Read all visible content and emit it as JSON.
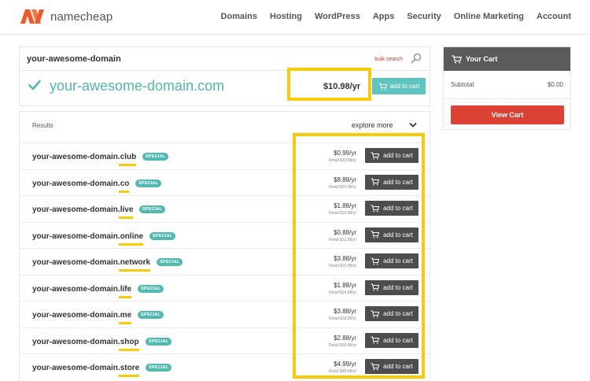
{
  "brand": {
    "name": "namecheap",
    "logo_color": "#f05a2a"
  },
  "nav": {
    "items": [
      "Domains",
      "Hosting",
      "WordPress",
      "Apps",
      "Security",
      "Online Marketing",
      "Account"
    ]
  },
  "search": {
    "value": "your-awesome-domain",
    "bulk_search_label": "bulk search",
    "icon": "search-icon"
  },
  "main_result": {
    "domain": "your-awesome-domain.com",
    "price": "$10.98/yr",
    "add_label": "add to cart",
    "status_icon": "check-icon",
    "accent_color": "#4fb8b0"
  },
  "results": {
    "label": "Results",
    "explore_more": "explore more",
    "badge_label": "SPECIAL",
    "add_label": "add to cart",
    "rows": [
      {
        "base": "your-awesome-domain",
        "tld": ".club",
        "price": "$0.99/yr",
        "retail": "Retail $10.88/yr"
      },
      {
        "base": "your-awesome-domain",
        "tld": ".co",
        "price": "$8.88/yr",
        "retail": "Retail $23.98/yr"
      },
      {
        "base": "your-awesome-domain",
        "tld": ".live",
        "price": "$1.88/yr",
        "retail": "Retail $19.88/yr"
      },
      {
        "base": "your-awesome-domain",
        "tld": ".online",
        "price": "$0.88/yr",
        "retail": "Retail $32.88/yr"
      },
      {
        "base": "your-awesome-domain",
        "tld": ".network",
        "price": "$3.88/yr",
        "retail": "Retail $15.88/yr"
      },
      {
        "base": "your-awesome-domain",
        "tld": ".life",
        "price": "$1.88/yr",
        "retail": "Retail $24.88/yr"
      },
      {
        "base": "your-awesome-domain",
        "tld": ".me",
        "price": "$3.88/yr",
        "retail": "Retail $18.99/yr"
      },
      {
        "base": "your-awesome-domain",
        "tld": ".shop",
        "price": "$2.88/yr",
        "retail": "Retail $30.88/yr"
      },
      {
        "base": "your-awesome-domain",
        "tld": ".store",
        "price": "$4.99/yr",
        "retail": "Retail $48.88/yr"
      }
    ]
  },
  "cart": {
    "title": "Your Cart",
    "subtotal_label": "Subtotal",
    "subtotal_value": "$0.00",
    "view_cart_label": "View Cart",
    "view_cart_color": "#dd4133"
  },
  "annotation_color": "#f8cb09"
}
